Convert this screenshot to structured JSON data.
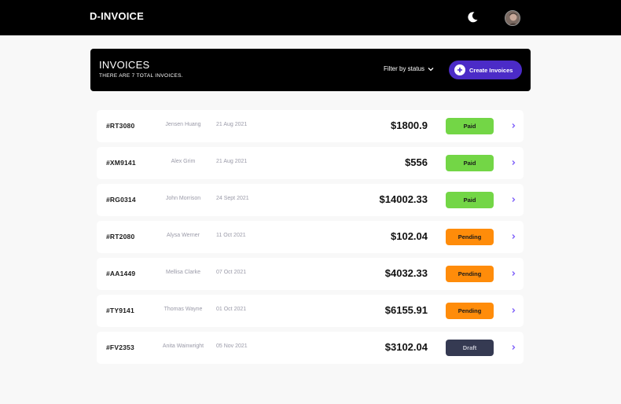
{
  "app": {
    "brand": "D-INVOICE"
  },
  "header": {
    "title": "INVOICES",
    "subtitle": "THERE ARE 7 TOTAL INVOICES.",
    "filter_label": "Filter by status",
    "create_label": "Create Invoices"
  },
  "icons": {
    "theme": "moon-icon",
    "avatar": "avatar",
    "filter": "chevron-down-icon",
    "create": "plus-icon",
    "row": "chevron-right-icon"
  },
  "colors": {
    "paid": "#73d646",
    "pending": "#ff8c0a",
    "draft": "#353a52",
    "accent": "#4b2bc7"
  },
  "invoices": [
    {
      "id": "#RT3080",
      "name": "Jensen Huang",
      "date": "21 Aug 2021",
      "amount": "$1800.9",
      "status": "Paid",
      "status_key": "paid"
    },
    {
      "id": "#XM9141",
      "name": "Alex Grim",
      "date": "21 Aug 2021",
      "amount": "$556",
      "status": "Paid",
      "status_key": "paid"
    },
    {
      "id": "#RG0314",
      "name": "John Morrison",
      "date": "24 Sept 2021",
      "amount": "$14002.33",
      "status": "Paid",
      "status_key": "paid"
    },
    {
      "id": "#RT2080",
      "name": "Alysa Werner",
      "date": "11 Oct 2021",
      "amount": "$102.04",
      "status": "Pending",
      "status_key": "pending"
    },
    {
      "id": "#AA1449",
      "name": "Mellisa Clarke",
      "date": "07 Oct 2021",
      "amount": "$4032.33",
      "status": "Pending",
      "status_key": "pending"
    },
    {
      "id": "#TY9141",
      "name": "Thomas Wayne",
      "date": "01 Oct 2021",
      "amount": "$6155.91",
      "status": "Pending",
      "status_key": "pending"
    },
    {
      "id": "#FV2353",
      "name": "Anita Wainwright",
      "date": "05 Nov 2021",
      "amount": "$3102.04",
      "status": "Draft",
      "status_key": "draft"
    }
  ]
}
